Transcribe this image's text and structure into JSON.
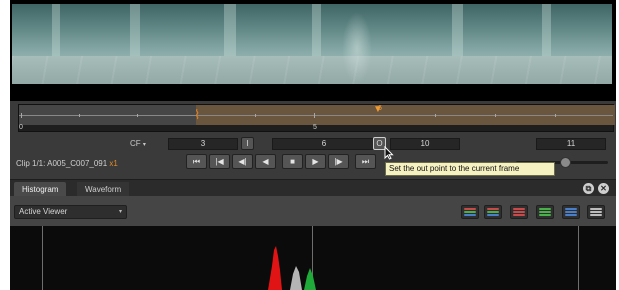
{
  "timeline": {
    "start_label": "0",
    "mid_label": "5",
    "playhead_label": "6"
  },
  "frames": {
    "cf_label": "CF",
    "cf_arrow": "▾",
    "in_value": "3",
    "in_button": "I",
    "current_value": "6",
    "out_button": "O",
    "out_value": "10",
    "last_value": "11"
  },
  "clip": {
    "label": "Clip 1/1: A005_C007_091",
    "speed": "x1"
  },
  "transport": {
    "first_frame": "⏮",
    "prev_key": "|◀",
    "step_back": "◀|",
    "play_backward": "◀",
    "stop": "■",
    "play_forward": "▶",
    "step_forward": "|▶",
    "last_frame": "⏭"
  },
  "tooltip": "Set the out point to the current frame",
  "panel": {
    "tabs": [
      "Histogram",
      "Waveform"
    ],
    "float_icon": "⧉",
    "close_icon": "✕",
    "viewer_select": "Active Viewer",
    "viewer_arrow": "▾"
  },
  "modes": [
    {
      "name": "rgb-mode",
      "colors": [
        "#c94a4a",
        "#4ab04a",
        "#4a7ec9"
      ]
    },
    {
      "name": "rgb-parade-mode",
      "colors": [
        "#c94a4a",
        "#4ab04a",
        "#4a7ec9"
      ]
    },
    {
      "name": "red-mode",
      "colors": [
        "#c94a4a",
        "#c94a4a",
        "#c94a4a"
      ]
    },
    {
      "name": "green-mode",
      "colors": [
        "#4ab04a",
        "#4ab04a",
        "#4ab04a"
      ]
    },
    {
      "name": "blue-mode",
      "colors": [
        "#4a7ec9",
        "#4a7ec9",
        "#4a7ec9"
      ]
    },
    {
      "name": "luma-mode",
      "colors": [
        "#bdbdbd",
        "#bdbdbd",
        "#bdbdbd"
      ]
    }
  ],
  "histogram": {
    "red_peak_color": "#e01414",
    "gray_peak_color": "#b5b5b5",
    "green_peak_color": "#1faa3a"
  },
  "colors": {
    "accent": "#e08a2a",
    "in_out_range": "#6a553e"
  }
}
